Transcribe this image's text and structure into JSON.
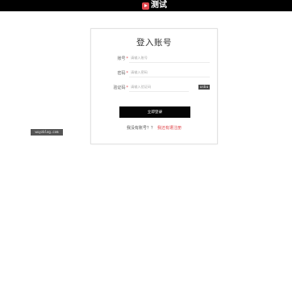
{
  "brand": {
    "text": "测试"
  },
  "login": {
    "title": "登入账号",
    "account": {
      "label": "账号",
      "required_mark": "*",
      "placeholder": "请输入账号"
    },
    "password": {
      "label": "密码",
      "required_mark": "*",
      "placeholder": "请输入密码"
    },
    "captcha": {
      "label": "验证码",
      "required_mark": "*",
      "placeholder": "请输入验证码",
      "image_text": "usbu"
    },
    "submit_label": "立即登录",
    "no_account_text": "我没有账号？？",
    "signup_link_text": "我还有遭注册"
  },
  "watermark": {
    "text": "wuyzblog.com"
  },
  "colors": {
    "accent": "#e0474c",
    "button_bg": "#050505",
    "topbar_bg": "#000000"
  }
}
